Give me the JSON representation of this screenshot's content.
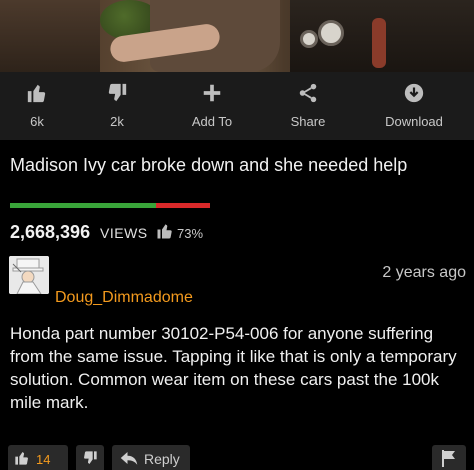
{
  "actions": [
    {
      "icon": "thumbs-up-icon",
      "label": "6k"
    },
    {
      "icon": "thumbs-down-icon",
      "label": "2k"
    },
    {
      "icon": "plus-icon",
      "label": "Add To"
    },
    {
      "icon": "share-icon",
      "label": "Share"
    },
    {
      "icon": "download-icon",
      "label": "Download"
    }
  ],
  "video": {
    "title": "Madison Ivy car broke down and she needed help",
    "views": "2,668,396",
    "views_label": "VIEWS",
    "rating_percent": "73%",
    "rating_fraction": 0.73
  },
  "comment": {
    "username": "Doug_Dimmadome",
    "time": "2 years ago",
    "body": "Honda part number 30102-P54-006 for anyone suffering from the same issue. Tapping it like that is only a temporary solution. Common wear item on these cars past the 100k mile mark.",
    "likes": "14",
    "reply_label": "Reply"
  },
  "colors": {
    "accent": "#f39a1e",
    "rating_good": "#3aa53a",
    "rating_bad": "#d9292a",
    "background": "#000000"
  }
}
